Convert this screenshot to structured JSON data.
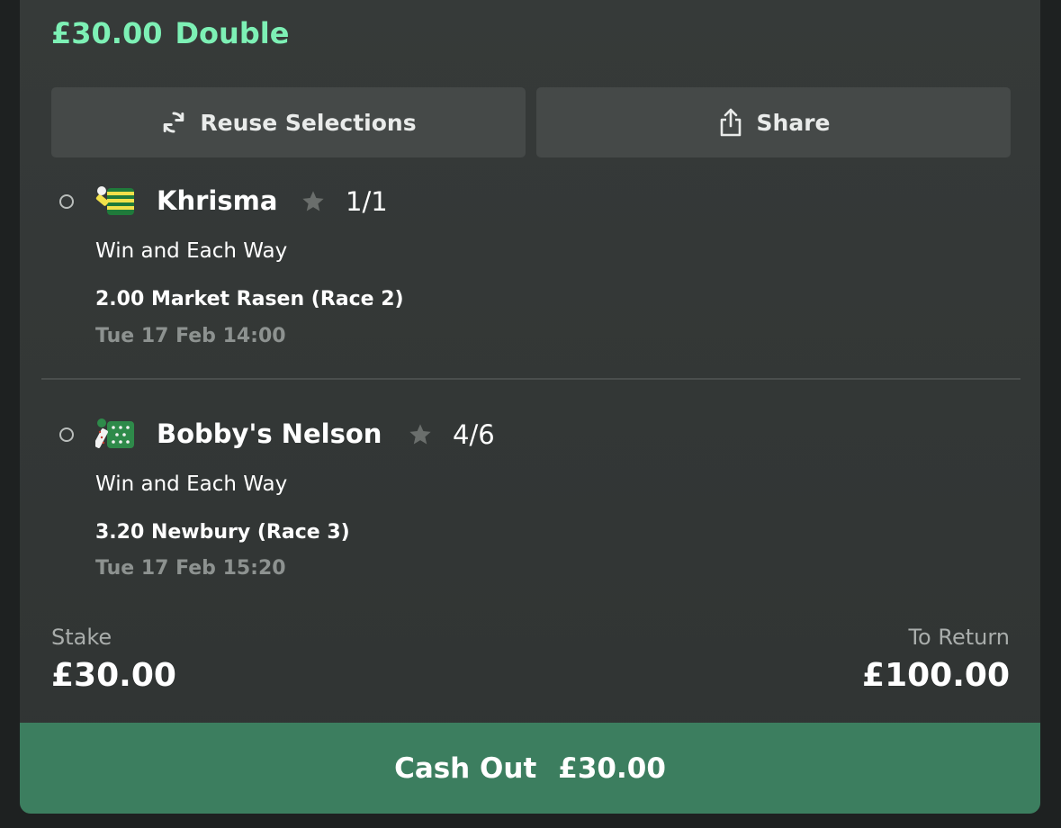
{
  "bet": {
    "amount": "£30.00",
    "type": "Double"
  },
  "actions": {
    "reuse_label": "Reuse Selections",
    "share_label": "Share"
  },
  "selections": [
    {
      "runner": "Khrisma",
      "odds": "1/1",
      "bet_type": "Win and Each Way",
      "race": "2.00 Market Rasen (Race 2)",
      "time": "Tue 17 Feb 14:00",
      "silk_icon": "jockey-silk-yellow-green-hoops-icon"
    },
    {
      "runner": "Bobby's Nelson",
      "odds": "4/6",
      "bet_type": "Win and Each Way",
      "race": "3.20 Newbury (Race 3)",
      "time": "Tue 17 Feb 15:20",
      "silk_icon": "jockey-silk-green-white-spots-icon"
    }
  ],
  "summary": {
    "stake_label": "Stake",
    "stake_value": "£30.00",
    "return_label": "To Return",
    "return_value": "£100.00"
  },
  "cashout": {
    "label": "Cash Out",
    "amount": "£30.00"
  },
  "colors": {
    "accent_green": "#7df0b5",
    "cashout_green": "#3c7e5f",
    "card_bg": "#363a39",
    "button_bg": "#454948",
    "muted_text": "#8d9290"
  }
}
